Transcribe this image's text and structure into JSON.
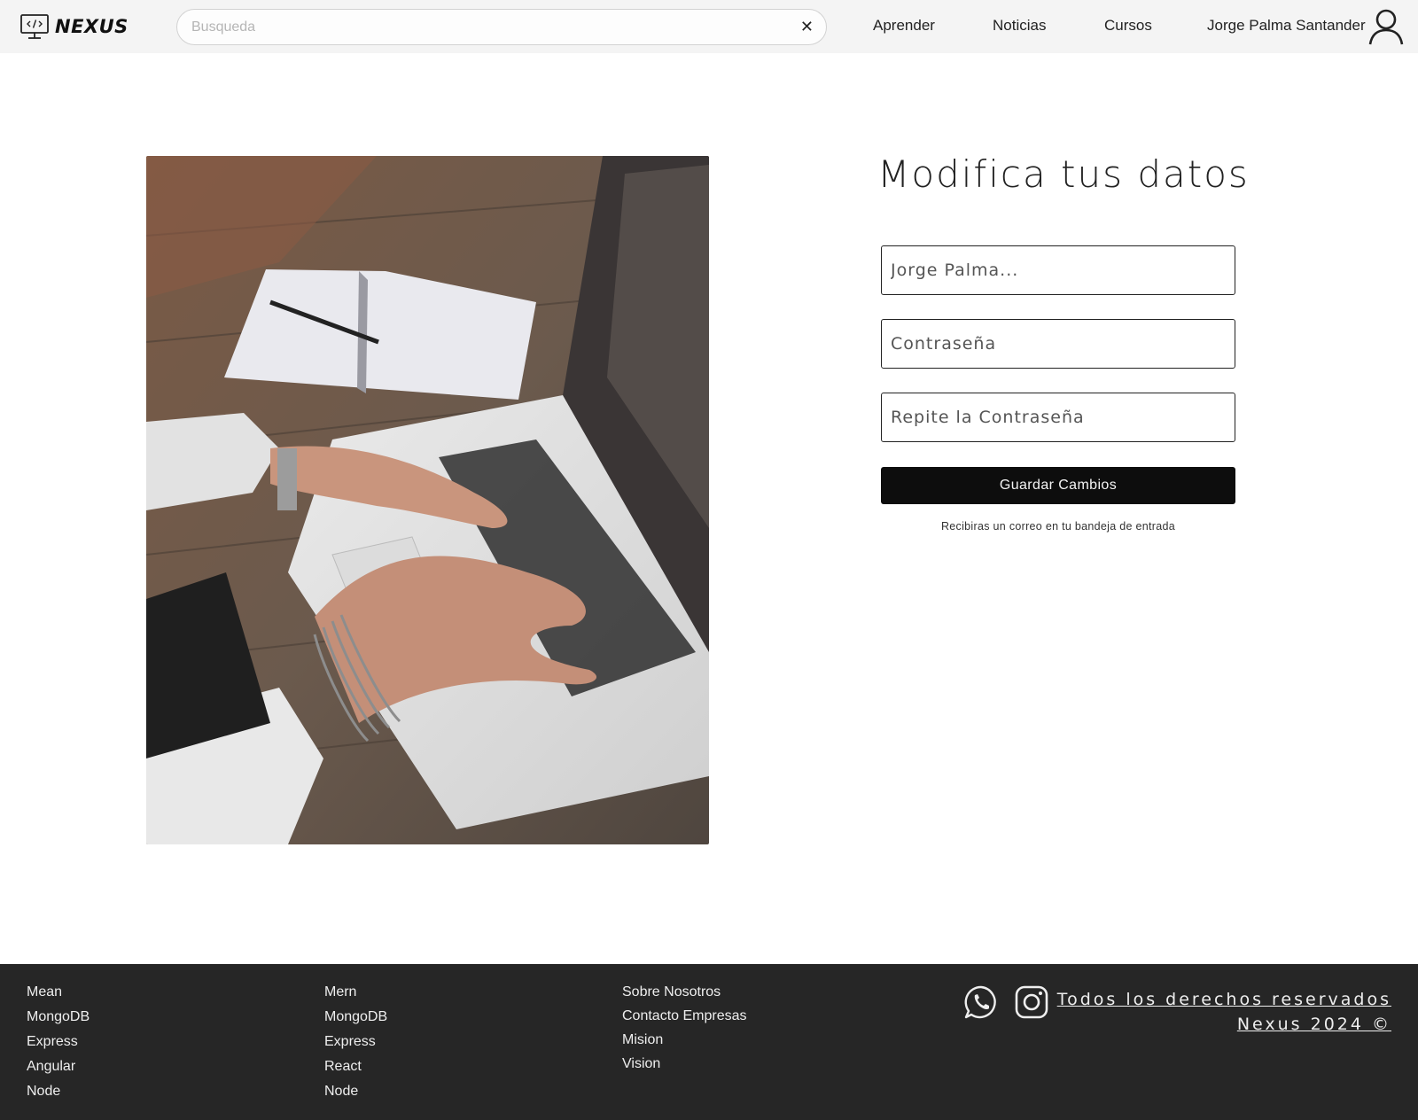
{
  "header": {
    "brand": "NEXUS",
    "search": {
      "placeholder": "Busqueda",
      "value": ""
    },
    "clear_symbol": "✕",
    "nav": [
      {
        "label": "Aprender"
      },
      {
        "label": "Noticias"
      },
      {
        "label": "Cursos"
      }
    ],
    "user_name": "Jorge Palma Santander"
  },
  "main": {
    "title": "Modifica tus datos",
    "fields": {
      "name_placeholder": "Jorge Palma...",
      "password_placeholder": "Contraseña",
      "repeat_password_placeholder": "Repite la Contraseña"
    },
    "save_label": "Guardar Cambios",
    "hint": "Recibiras un correo en tu bandeja de entrada"
  },
  "footer": {
    "col1": [
      "Mean",
      "MongoDB",
      "Express",
      "Angular",
      "Node"
    ],
    "col2": [
      "Mern",
      "MongoDB",
      "Express",
      "React",
      "Node"
    ],
    "col3": [
      "Sobre Nosotros",
      "Contacto Empresas",
      "Mision",
      "Vision"
    ],
    "copyright_line1": "Todos los derechos reservados",
    "copyright_line2": "Nexus 2024 ©",
    "social_icons": [
      "whatsapp-icon",
      "instagram-icon"
    ]
  },
  "colors": {
    "navbar_bg": "#f4f4f4",
    "footer_bg": "#262626",
    "button_bg": "#0d0d0d"
  }
}
